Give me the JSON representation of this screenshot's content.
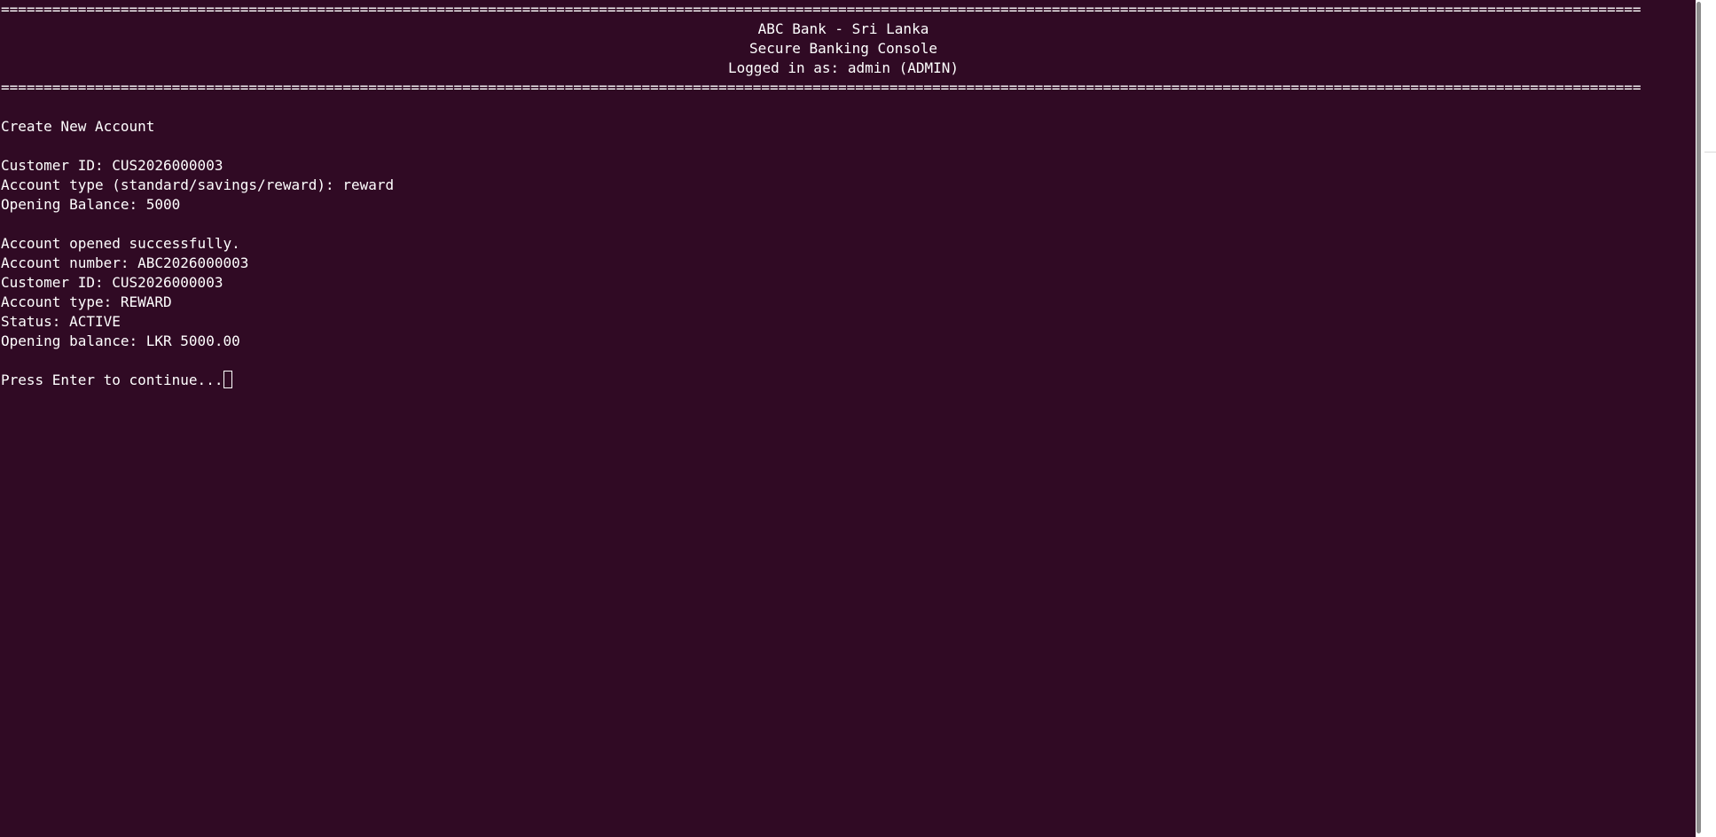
{
  "terminal": {
    "background_color": "#300a24",
    "rule_top": "================================================================================================================================================================================================",
    "header": {
      "bank_name": "ABC Bank - Sri Lanka",
      "console_name": "Secure Banking Console",
      "logged_in": "Logged in as: admin (ADMIN)"
    },
    "rule_bottom": "================================================================================================================================================================================================",
    "section_title": "Create New Account",
    "inputs": {
      "customer_id": "Customer ID: CUS2026000003",
      "account_type": "Account type (standard/savings/reward): reward",
      "opening_balance": "Opening Balance: 5000"
    },
    "result": {
      "message": "Account opened successfully.",
      "account_number": "Account number: ABC2026000003",
      "customer_id": "Customer ID: CUS2026000003",
      "account_type": "Account type: REWARD",
      "status": "Status: ACTIVE",
      "opening_balance": "Opening balance: LKR 5000.00"
    },
    "prompt": "Press Enter to continue..."
  }
}
